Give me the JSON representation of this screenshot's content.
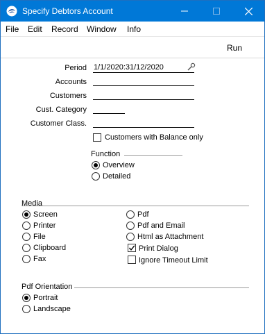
{
  "window": {
    "title": "Specify Debtors Account",
    "titlebar_color": "#0078d7",
    "controls": {
      "minimize": "minimize-icon",
      "maximize": "maximize-icon",
      "close": "close-icon"
    }
  },
  "menu": [
    "File",
    "Edit",
    "Record",
    "Window",
    "Info"
  ],
  "toolbar": {
    "run_label": "Run"
  },
  "fields": {
    "period_label": "Period",
    "period_value": "1/1/2020:31/12/2020",
    "accounts_label": "Accounts",
    "accounts_value": "",
    "customers_label": "Customers",
    "customers_value": "",
    "cust_category_label": "Cust. Category",
    "cust_category_value": "",
    "customer_class_label": "Customer Class.",
    "customer_class_value": "",
    "balance_only_label": "Customers with Balance only",
    "balance_only_checked": false
  },
  "function": {
    "title": "Function",
    "options": [
      "Overview",
      "Detailed"
    ],
    "selected": "Overview"
  },
  "media": {
    "title": "Media",
    "left_options": [
      "Screen",
      "Printer",
      "File",
      "Clipboard",
      "Fax"
    ],
    "right_options": [
      "Pdf",
      "Pdf and Email",
      "Html as Attachment"
    ],
    "selected": "Screen",
    "print_dialog_label": "Print Dialog",
    "print_dialog_checked": true,
    "ignore_timeout_label": "Ignore Timeout Limit",
    "ignore_timeout_checked": false
  },
  "pdf_orientation": {
    "title": "Pdf Orientation",
    "options": [
      "Portrait",
      "Landscape"
    ],
    "selected": "Portrait"
  }
}
